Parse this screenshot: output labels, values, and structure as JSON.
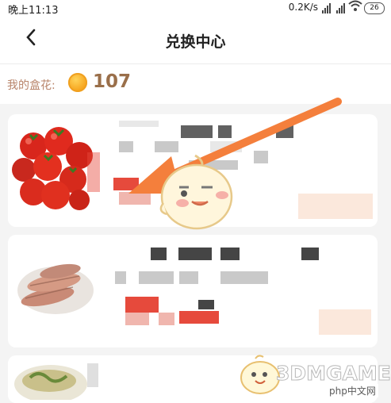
{
  "status_bar": {
    "time": "晚上11:13",
    "network_speed": "0.2K/s",
    "battery": "26"
  },
  "header": {
    "back_icon": "chevron-left-icon",
    "title": "兑换中心"
  },
  "points": {
    "label": "我的盒花:",
    "coin_icon": "coin-icon",
    "value": "107"
  },
  "watermark": {
    "brand": "3DMGAME",
    "site": "php中文网"
  },
  "colors": {
    "accent_orange": "#f47f3c",
    "price_red": "#e64a3c",
    "label_brown": "#b8846a"
  }
}
